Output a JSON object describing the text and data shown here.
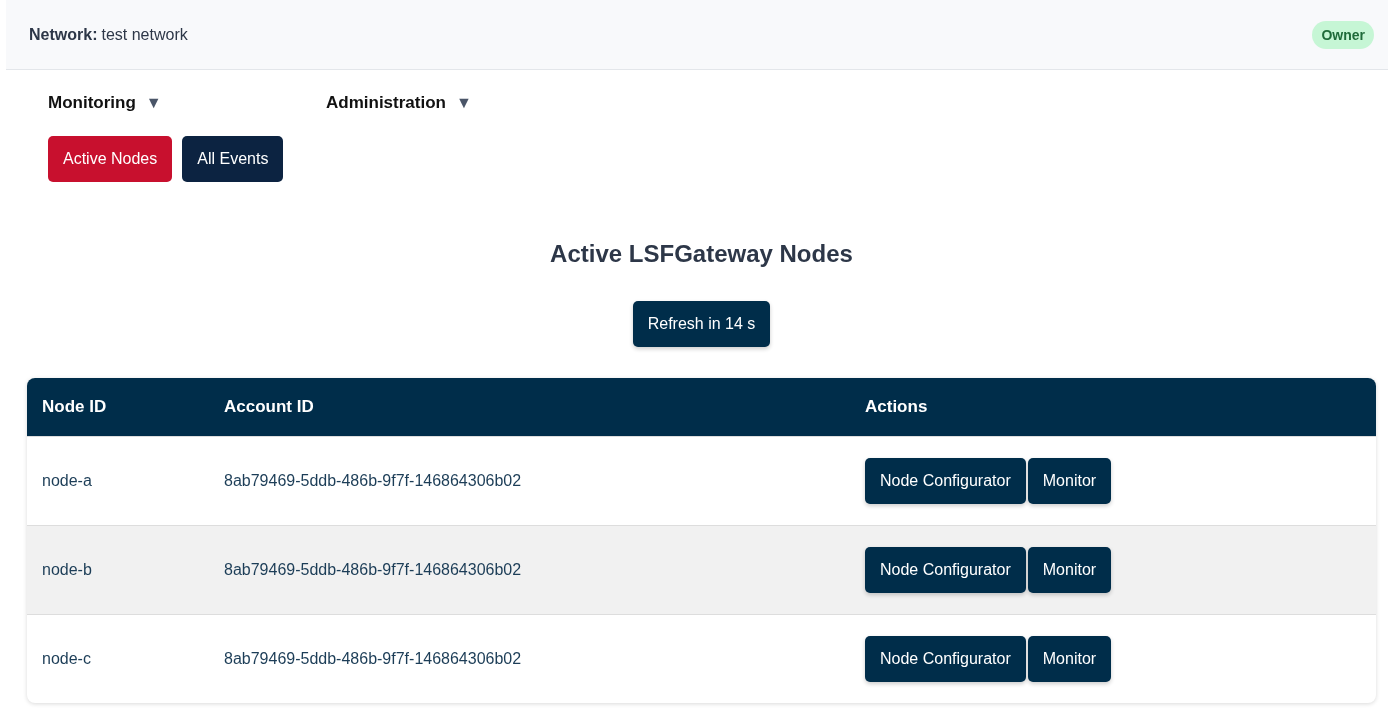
{
  "header": {
    "network_label": "Network:",
    "network_name": "test network",
    "role_badge": "Owner"
  },
  "menus": [
    {
      "label": "Monitoring",
      "caret": "▼"
    },
    {
      "label": "Administration",
      "caret": "▼"
    }
  ],
  "tabs": [
    {
      "label": "Active Nodes",
      "selected": true
    },
    {
      "label": "All Events",
      "selected": false
    }
  ],
  "title": "Active LSFGateway Nodes",
  "refresh_button": "Refresh in 14 s",
  "table": {
    "columns": [
      "Node ID",
      "Account ID",
      "Actions"
    ],
    "rows": [
      {
        "node_id": "node-a",
        "account_id": "8ab79469-5ddb-486b-9f7f-146864306b02",
        "actions": [
          "Node Configurator",
          "Monitor"
        ]
      },
      {
        "node_id": "node-b",
        "account_id": "8ab79469-5ddb-486b-9f7f-146864306b02",
        "actions": [
          "Node Configurator",
          "Monitor"
        ]
      },
      {
        "node_id": "node-c",
        "account_id": "8ab79469-5ddb-486b-9f7f-146864306b02",
        "actions": [
          "Node Configurator",
          "Monitor"
        ]
      }
    ]
  }
}
